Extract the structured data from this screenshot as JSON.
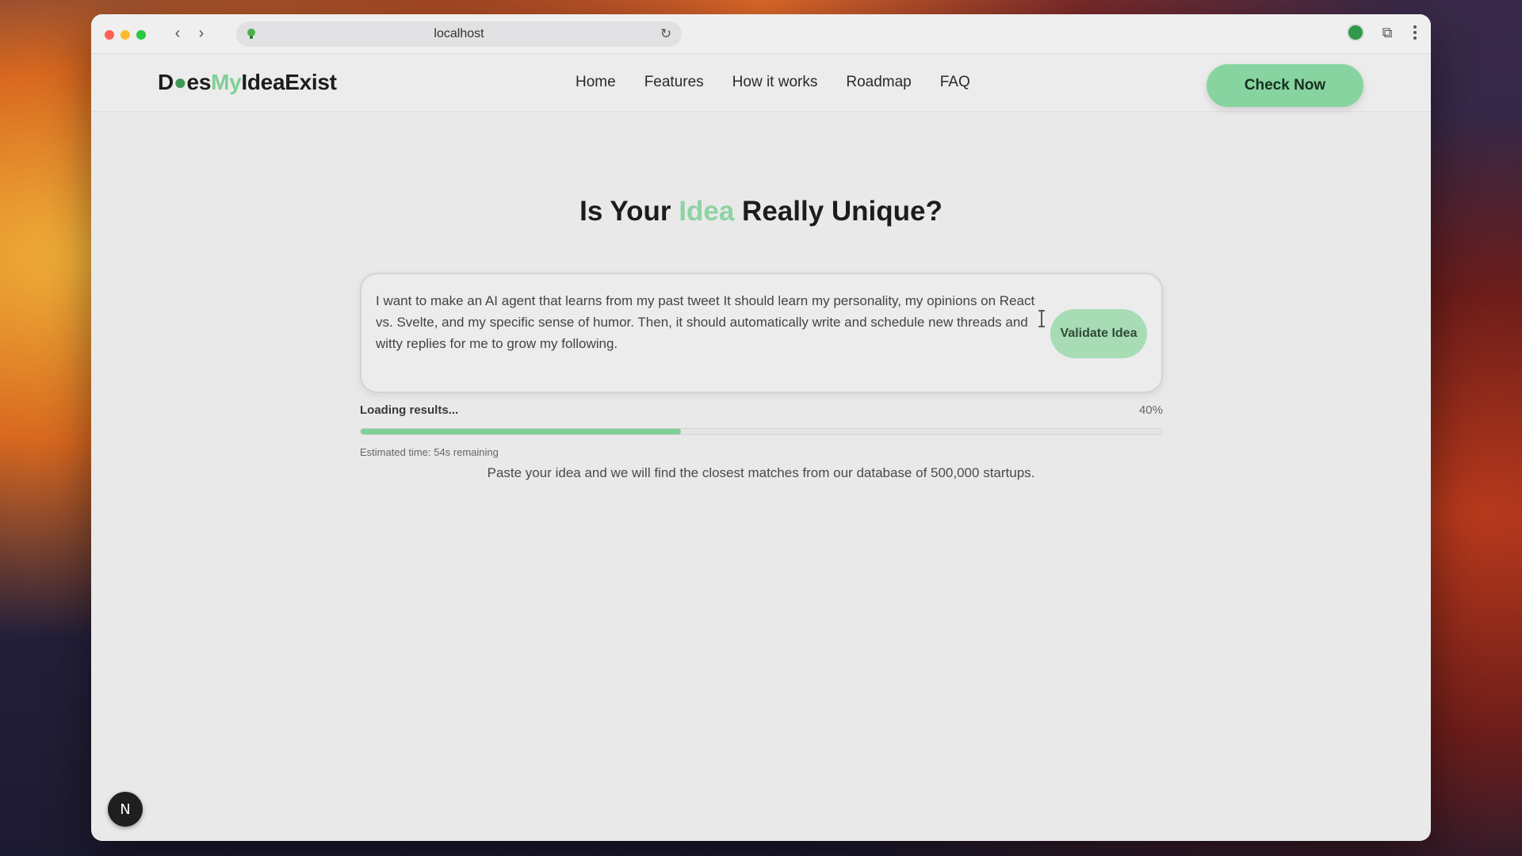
{
  "browser": {
    "url": "localhost",
    "back_glyph": "‹",
    "forward_glyph": "›",
    "reload_glyph": "↻",
    "extensions_glyph": "⧉"
  },
  "site": {
    "logo": {
      "part1": "D",
      "part2": "es",
      "part3": "My",
      "part4": "IdeaExist"
    },
    "nav": [
      "Home",
      "Features",
      "How it works",
      "Roadmap",
      "FAQ"
    ],
    "cta": "Check Now"
  },
  "hero": {
    "title_before": "Is Your ",
    "title_accent": "Idea",
    "title_after": " Really Unique?"
  },
  "idea_input": {
    "value": "I want to make an AI agent that learns from my past tweet It should learn my personality, my opinions on React vs. Svelte, and my specific sense of humor. Then, it should automatically write and schedule new threads and witty replies for me to grow my following.",
    "button": "Validate Idea"
  },
  "progress": {
    "label": "Loading results...",
    "percent_text": "40%",
    "percent": 40,
    "estimate": "Estimated time: 54s remaining"
  },
  "subtitle": "Paste your idea and we will find the closest matches from our database of 500,000 startups.",
  "badge": "N",
  "colors": {
    "accent": "#7fcf96",
    "cta": "#88d4a0"
  }
}
